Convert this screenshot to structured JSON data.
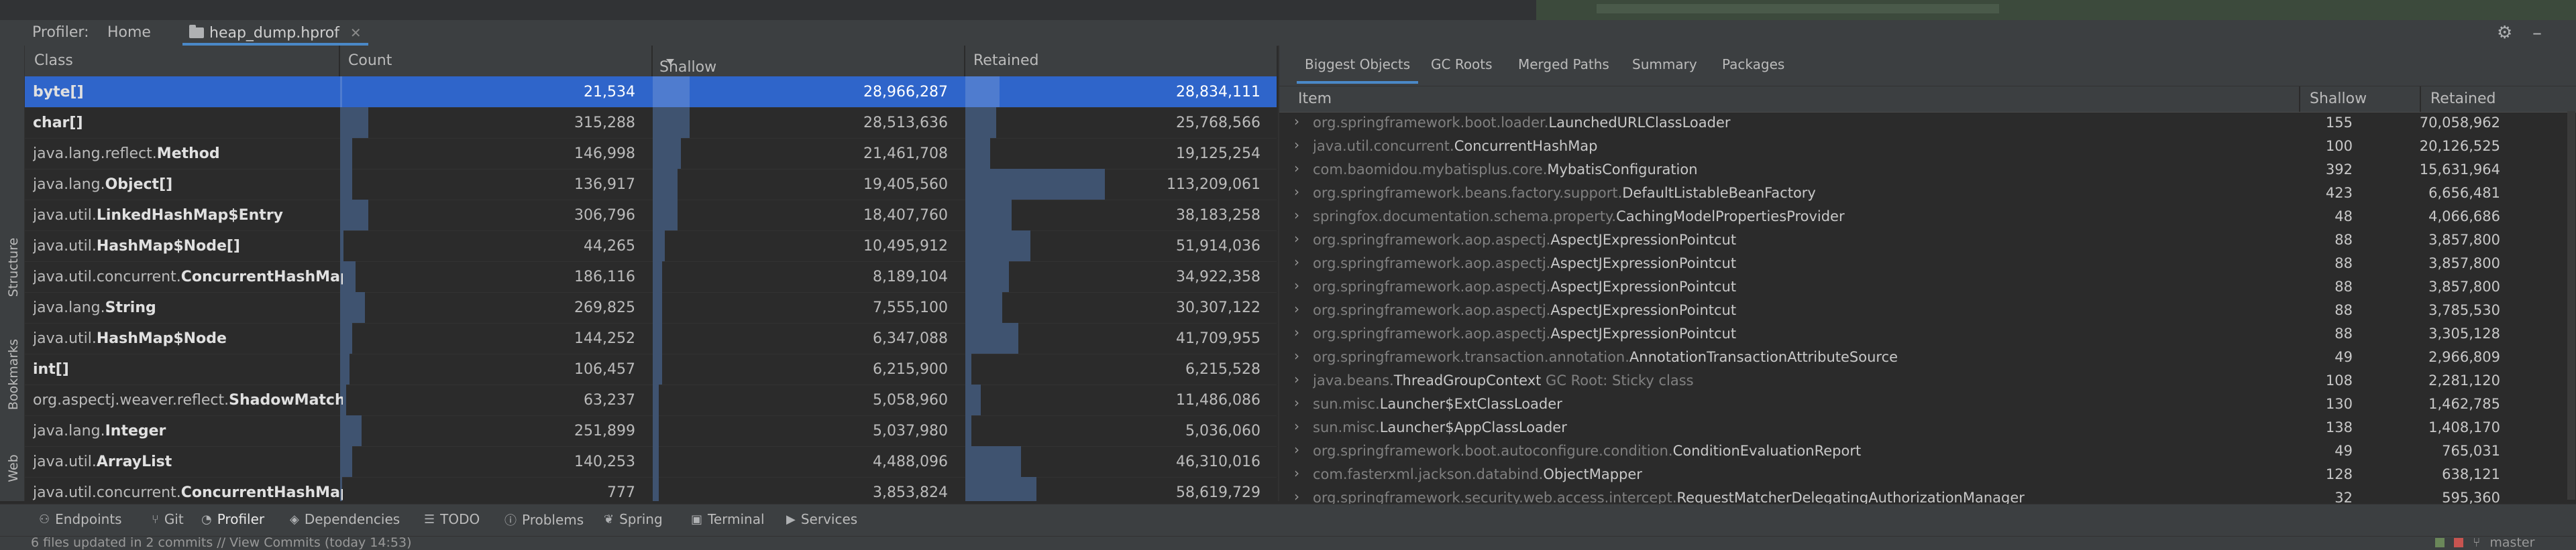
{
  "toolwindow": {
    "title": "Profiler:",
    "tabs": [
      {
        "label": "Home"
      },
      {
        "label": "heap_dump.hprof"
      }
    ]
  },
  "left_strip": {
    "items": [
      "Structure",
      "Bookmarks",
      "Web"
    ]
  },
  "class_table": {
    "headers": {
      "class": "Class",
      "count": "Count",
      "shallow": "Shallow",
      "retained": "Retained"
    },
    "rows": [
      {
        "pkg": "",
        "name": "byte[]",
        "count": "21,534",
        "shallow": "28,966,287",
        "retained": "28,834,111",
        "count_frac": 0.0,
        "shallow_frac": 0.12,
        "retained_frac": 0.11
      },
      {
        "pkg": "",
        "name": "char[]",
        "count": "315,288",
        "shallow": "28,513,636",
        "retained": "25,768,566",
        "count_frac": 0.09,
        "shallow_frac": 0.12,
        "retained_frac": 0.1
      },
      {
        "pkg": "java.lang.reflect.",
        "name": "Method",
        "count": "146,998",
        "shallow": "21,461,708",
        "retained": "19,125,254",
        "count_frac": 0.04,
        "shallow_frac": 0.09,
        "retained_frac": 0.08
      },
      {
        "pkg": "java.lang.",
        "name": "Object[]",
        "count": "136,917",
        "shallow": "19,405,560",
        "retained": "113,209,061",
        "count_frac": 0.04,
        "shallow_frac": 0.08,
        "retained_frac": 0.45
      },
      {
        "pkg": "java.util.",
        "name": "LinkedHashMap$Entry",
        "count": "306,796",
        "shallow": "18,407,760",
        "retained": "38,183,258",
        "count_frac": 0.09,
        "shallow_frac": 0.08,
        "retained_frac": 0.15
      },
      {
        "pkg": "java.util.",
        "name": "HashMap$Node[]",
        "count": "44,265",
        "shallow": "10,495,912",
        "retained": "51,914,036",
        "count_frac": 0.01,
        "shallow_frac": 0.04,
        "retained_frac": 0.21
      },
      {
        "pkg": "java.util.concurrent.",
        "name": "ConcurrentHashMap$Node",
        "count": "186,116",
        "shallow": "8,189,104",
        "retained": "34,922,358",
        "count_frac": 0.05,
        "shallow_frac": 0.03,
        "retained_frac": 0.14
      },
      {
        "pkg": "java.lang.",
        "name": "String",
        "count": "269,825",
        "shallow": "7,555,100",
        "retained": "30,307,122",
        "count_frac": 0.08,
        "shallow_frac": 0.03,
        "retained_frac": 0.12
      },
      {
        "pkg": "java.util.",
        "name": "HashMap$Node",
        "count": "144,252",
        "shallow": "6,347,088",
        "retained": "41,709,955",
        "count_frac": 0.04,
        "shallow_frac": 0.03,
        "retained_frac": 0.17
      },
      {
        "pkg": "",
        "name": "int[]",
        "count": "106,457",
        "shallow": "6,215,900",
        "retained": "6,215,528",
        "count_frac": 0.03,
        "shallow_frac": 0.03,
        "retained_frac": 0.02
      },
      {
        "pkg": "org.aspectj.weaver.reflect.",
        "name": "ShadowMatchImpl",
        "count": "63,237",
        "shallow": "5,058,960",
        "retained": "11,486,086",
        "count_frac": 0.02,
        "shallow_frac": 0.02,
        "retained_frac": 0.05
      },
      {
        "pkg": "java.lang.",
        "name": "Integer",
        "count": "251,899",
        "shallow": "5,037,980",
        "retained": "5,036,060",
        "count_frac": 0.07,
        "shallow_frac": 0.02,
        "retained_frac": 0.02
      },
      {
        "pkg": "java.util.",
        "name": "ArrayList",
        "count": "140,253",
        "shallow": "4,488,096",
        "retained": "46,310,016",
        "count_frac": 0.04,
        "shallow_frac": 0.02,
        "retained_frac": 0.18
      },
      {
        "pkg": "java.util.concurrent.",
        "name": "ConcurrentHashMap$Segment",
        "count": "777",
        "shallow": "3,853,824",
        "retained": "58,619,729",
        "count_frac": 0.0,
        "shallow_frac": 0.02,
        "retained_frac": 0.23
      }
    ]
  },
  "right_panel": {
    "tabs": [
      {
        "label": "Biggest Objects",
        "active": true
      },
      {
        "label": "GC Roots",
        "active": false
      },
      {
        "label": "Merged Paths",
        "active": false
      },
      {
        "label": "Summary",
        "active": false
      },
      {
        "label": "Packages",
        "active": false
      }
    ],
    "headers": {
      "item": "Item",
      "shallow": "Shallow",
      "retained": "Retained"
    },
    "rows": [
      {
        "pkg": "org.springframework.boot.loader.",
        "name": "LaunchedURLClassLoader",
        "suffix": "",
        "shallow": "155",
        "retained": "70,058,962"
      },
      {
        "pkg": "java.util.concurrent.",
        "name": "ConcurrentHashMap",
        "suffix": "",
        "shallow": "100",
        "retained": "20,126,525"
      },
      {
        "pkg": "com.baomidou.mybatisplus.core.",
        "name": "MybatisConfiguration",
        "suffix": "",
        "shallow": "392",
        "retained": "15,631,964"
      },
      {
        "pkg": "org.springframework.beans.factory.support.",
        "name": "DefaultListableBeanFactory",
        "suffix": "",
        "shallow": "423",
        "retained": "6,656,481"
      },
      {
        "pkg": "springfox.documentation.schema.property.",
        "name": "CachingModelPropertiesProvider",
        "suffix": "",
        "shallow": "48",
        "retained": "4,066,686"
      },
      {
        "pkg": "org.springframework.aop.aspectj.",
        "name": "AspectJExpressionPointcut",
        "suffix": "",
        "shallow": "88",
        "retained": "3,857,800"
      },
      {
        "pkg": "org.springframework.aop.aspectj.",
        "name": "AspectJExpressionPointcut",
        "suffix": "",
        "shallow": "88",
        "retained": "3,857,800"
      },
      {
        "pkg": "org.springframework.aop.aspectj.",
        "name": "AspectJExpressionPointcut",
        "suffix": "",
        "shallow": "88",
        "retained": "3,857,800"
      },
      {
        "pkg": "org.springframework.aop.aspectj.",
        "name": "AspectJExpressionPointcut",
        "suffix": "",
        "shallow": "88",
        "retained": "3,785,530"
      },
      {
        "pkg": "org.springframework.aop.aspectj.",
        "name": "AspectJExpressionPointcut",
        "suffix": "",
        "shallow": "88",
        "retained": "3,305,128"
      },
      {
        "pkg": "org.springframework.transaction.annotation.",
        "name": "AnnotationTransactionAttributeSource",
        "suffix": "",
        "shallow": "49",
        "retained": "2,966,809"
      },
      {
        "pkg": "java.beans.",
        "name": "ThreadGroupContext",
        "suffix": "  GC Root: Sticky class",
        "shallow": "108",
        "retained": "2,281,120"
      },
      {
        "pkg": "sun.misc.",
        "name": "Launcher$ExtClassLoader",
        "suffix": "",
        "shallow": "130",
        "retained": "1,462,785"
      },
      {
        "pkg": "sun.misc.",
        "name": "Launcher$AppClassLoader",
        "suffix": "",
        "shallow": "138",
        "retained": "1,408,170"
      },
      {
        "pkg": "org.springframework.boot.autoconfigure.condition.",
        "name": "ConditionEvaluationReport",
        "suffix": "",
        "shallow": "49",
        "retained": "765,031"
      },
      {
        "pkg": "com.fasterxml.jackson.databind.",
        "name": "ObjectMapper",
        "suffix": "",
        "shallow": "128",
        "retained": "638,121"
      },
      {
        "pkg": "org.springframework.security.web.access.intercept.",
        "name": "RequestMatcherDelegatingAuthorizationManager",
        "suffix": "",
        "shallow": "32",
        "retained": "595,360"
      }
    ]
  },
  "bottom_bar": {
    "items": [
      {
        "label": "Endpoints",
        "icon": "endpoints-icon",
        "glyph": "⚇"
      },
      {
        "label": "Git",
        "icon": "git-icon",
        "glyph": "⑂"
      },
      {
        "label": "Profiler",
        "icon": "profiler-icon",
        "glyph": "◔",
        "active": true
      },
      {
        "label": "Dependencies",
        "icon": "dependencies-icon",
        "glyph": "◈"
      },
      {
        "label": "TODO",
        "icon": "todo-icon",
        "glyph": "☰"
      },
      {
        "label": "Problems",
        "icon": "problems-icon",
        "glyph": "ⓘ"
      },
      {
        "label": "Spring",
        "icon": "spring-icon",
        "glyph": "❦"
      },
      {
        "label": "Terminal",
        "icon": "terminal-icon",
        "glyph": "▣"
      },
      {
        "label": "Services",
        "icon": "services-icon",
        "glyph": "▶"
      }
    ]
  },
  "status_bar": {
    "message": "6 files updated in 2 commits // View Commits (today 14:53)",
    "branch": "master"
  },
  "colors": {
    "selection": "#2f65ca",
    "bar": "#3f5370",
    "accent": "#4a88c7"
  }
}
